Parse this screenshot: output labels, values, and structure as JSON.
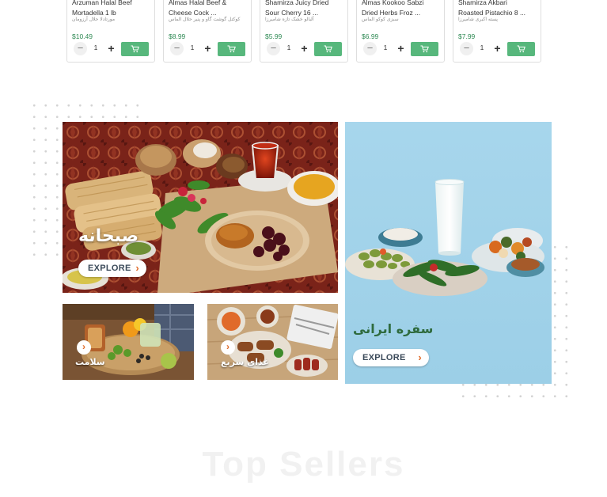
{
  "products": [
    {
      "name": "Arzuman Halal Beef\nMortadella 1 lb",
      "alt": "مورتادلا حلال آرزومان",
      "price": "$10.49",
      "qty": "1"
    },
    {
      "name": "Almas Halal Beef &\nCheese Cock ...",
      "alt": "کوکتل گوشت گاو و پنیر حلال الماس",
      "price": "$8.99",
      "qty": "1"
    },
    {
      "name": "Shamirza Juicy Dried\nSour Cherry 16 ...",
      "alt": "آلبالو خشک تازه شامیرزا",
      "price": "$5.99",
      "qty": "1"
    },
    {
      "name": "Almas Kookoo Sabzi\nDried Herbs Froz ...",
      "alt": "سبزی کوکو الماس",
      "price": "$6.99",
      "qty": "1"
    },
    {
      "name": "Shamirza Akbari\nRoasted Pistachio 8 ...",
      "alt": "پسته اکبری شامیرزا",
      "price": "$7.99",
      "qty": "1"
    }
  ],
  "banners": {
    "breakfast": {
      "title": "صبحانه",
      "button": "EXPLORE"
    },
    "sofreh": {
      "title": "سفره ایرانی",
      "button": "EXPLORE"
    },
    "healthy": {
      "title": "سلامت"
    },
    "fastfood": {
      "title": "غذای سریع"
    }
  },
  "section": {
    "title": "Top Sellers"
  },
  "colors": {
    "accent": "#57b77c",
    "price": "#2f8a54",
    "chevron": "#e06c2b",
    "sky": "#a9d7ec"
  }
}
